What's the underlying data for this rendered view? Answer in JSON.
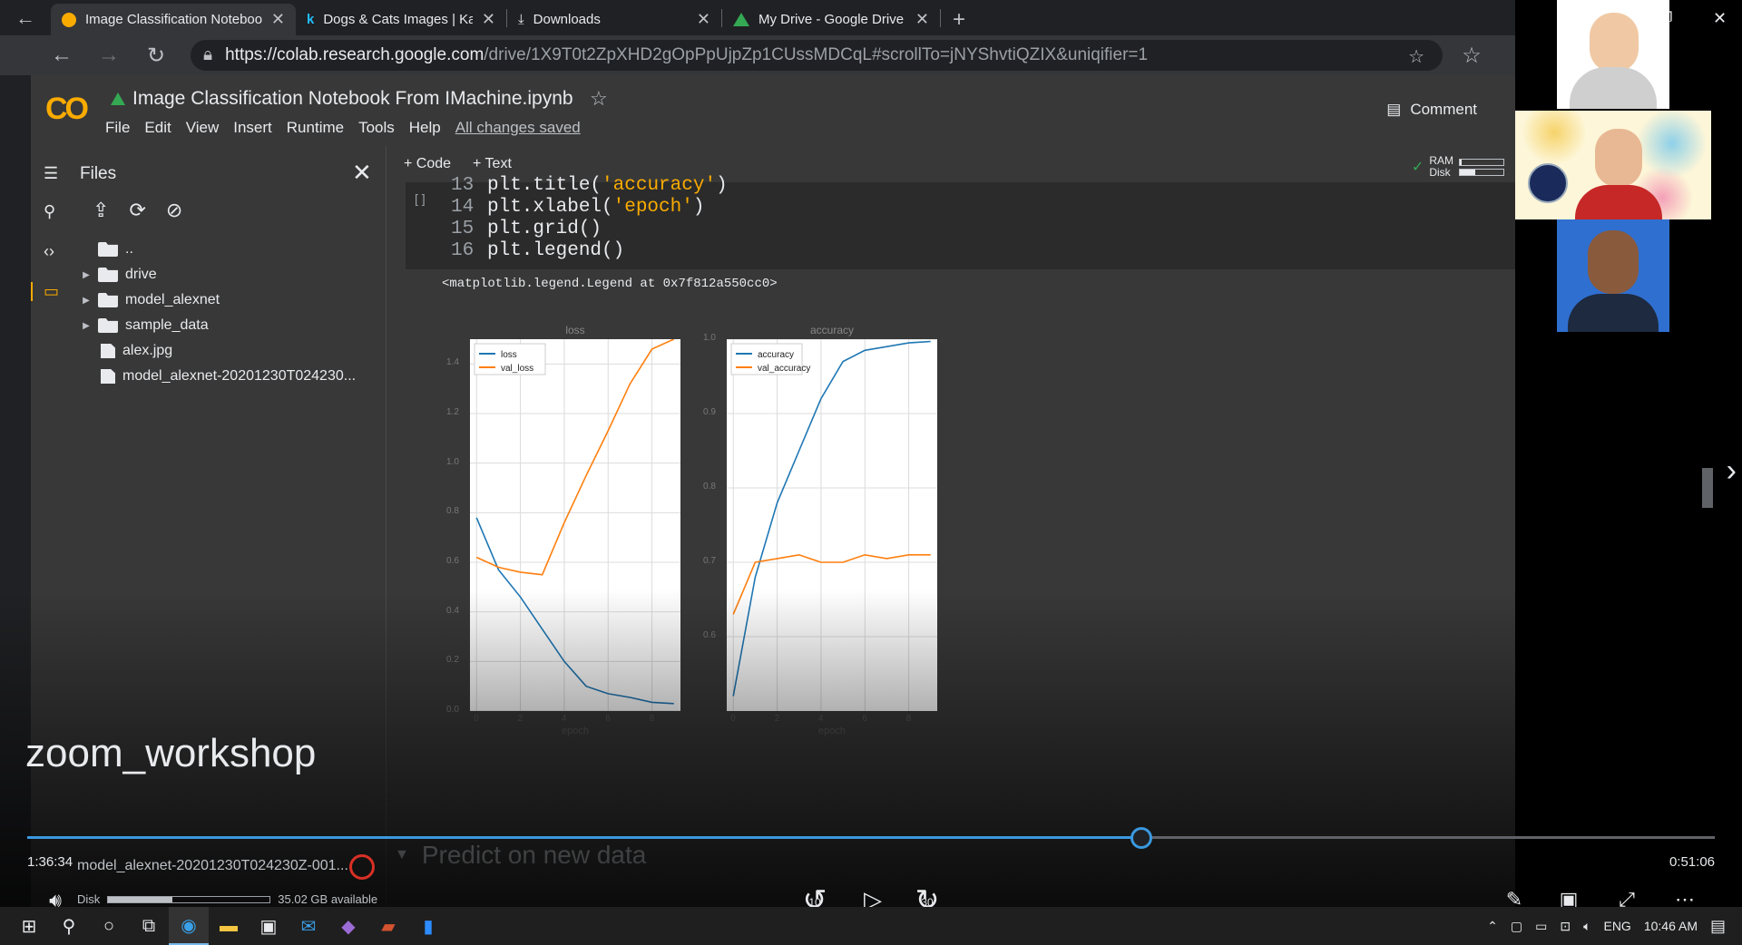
{
  "tabs": [
    {
      "title": "Image Classification Notebook F",
      "icon": "colab-icon",
      "active": true
    },
    {
      "title": "Dogs & Cats Images | Kaggle",
      "icon": "kaggle-icon",
      "active": false
    },
    {
      "title": "Downloads",
      "icon": "download-icon",
      "active": false
    },
    {
      "title": "My Drive - Google Drive",
      "icon": "drive-icon",
      "active": false
    }
  ],
  "address": {
    "host": "https://colab.research.google.com",
    "path": "/drive/1X9T0t2ZpXHD2gOpPpUjpZp1CUssMDCqL#scrollTo=jNYShvtiQZIX&uniqifier=1"
  },
  "colab": {
    "logo": "CO",
    "notebook_title": "Image Classification Notebook From IMachine.ipynb",
    "menu": [
      "File",
      "Edit",
      "View",
      "Insert",
      "Runtime",
      "Tools",
      "Help"
    ],
    "save_status": "All changes saved",
    "comment_label": "Comment",
    "add_code": "+ Code",
    "add_text": "+ Text",
    "ram_label": "RAM",
    "disk_label": "Disk",
    "ram_fraction": 0.05,
    "disk_fraction": 0.35
  },
  "sidebar": {
    "title": "Files",
    "tree": [
      {
        "name": "..",
        "kind": "up",
        "expandable": false
      },
      {
        "name": "drive",
        "kind": "folder",
        "expandable": true
      },
      {
        "name": "model_alexnet",
        "kind": "folder",
        "expandable": true
      },
      {
        "name": "sample_data",
        "kind": "folder",
        "expandable": true
      },
      {
        "name": "alex.jpg",
        "kind": "file",
        "expandable": false
      },
      {
        "name": "model_alexnet-20201230T024230...",
        "kind": "file",
        "expandable": false
      }
    ]
  },
  "code_cell": {
    "run_marker": "[ ]",
    "lines": [
      {
        "n": "13",
        "pre": "plt.title(",
        "str": "'accuracy'",
        "post": ")"
      },
      {
        "n": "14",
        "pre": "plt.xlabel(",
        "str": "'epoch'",
        "post": ")"
      },
      {
        "n": "15",
        "pre": "plt.grid()",
        "str": "",
        "post": ""
      },
      {
        "n": "16",
        "pre": "plt.legend()",
        "str": "",
        "post": ""
      }
    ],
    "output": "<matplotlib.legend.Legend at 0x7f812a550cc0>"
  },
  "chart_data": [
    {
      "type": "line",
      "title": "loss",
      "xlabel": "epoch",
      "ylim": [
        0.0,
        1.5
      ],
      "xlim": [
        -0.3,
        9.3
      ],
      "xticks": [
        0,
        2,
        4,
        6,
        8
      ],
      "yticks": [
        0.0,
        0.2,
        0.4,
        0.6,
        0.8,
        1.0,
        1.2,
        1.4
      ],
      "grid": true,
      "legend": "top-left",
      "x": [
        0,
        1,
        2,
        3,
        4,
        5,
        6,
        7,
        8,
        9
      ],
      "series": [
        {
          "name": "loss",
          "color": "#1f77b4",
          "values": [
            0.78,
            0.57,
            0.46,
            0.33,
            0.2,
            0.1,
            0.07,
            0.055,
            0.035,
            0.03
          ]
        },
        {
          "name": "val_loss",
          "color": "#ff7f0e",
          "values": [
            0.62,
            0.58,
            0.56,
            0.55,
            0.76,
            0.95,
            1.13,
            1.32,
            1.46,
            1.5
          ]
        }
      ]
    },
    {
      "type": "line",
      "title": "accuracy",
      "xlabel": "epoch",
      "ylim": [
        0.5,
        1.0
      ],
      "xlim": [
        -0.3,
        9.3
      ],
      "xticks": [
        0,
        2,
        4,
        6,
        8
      ],
      "yticks": [
        0.6,
        0.7,
        0.8,
        0.9,
        1.0
      ],
      "grid": true,
      "legend": "top-left",
      "x": [
        0,
        1,
        2,
        3,
        4,
        5,
        6,
        7,
        8,
        9
      ],
      "series": [
        {
          "name": "accuracy",
          "color": "#1f77b4",
          "values": [
            0.52,
            0.68,
            0.78,
            0.85,
            0.92,
            0.97,
            0.985,
            0.99,
            0.995,
            0.997
          ]
        },
        {
          "name": "val_accuracy",
          "color": "#ff7f0e",
          "values": [
            0.63,
            0.7,
            0.705,
            0.71,
            0.7,
            0.7,
            0.71,
            0.705,
            0.71,
            0.71
          ]
        }
      ]
    }
  ],
  "next_section": "Predict on new data",
  "recording_label": "zoom_workshop",
  "player": {
    "elapsed": "1:36:34",
    "total": "0:51:06",
    "progress_fraction": 0.66,
    "snackbar_file": "model_alexnet-20201230T024230Z-001...",
    "disk_available": "35.02 GB available",
    "disk_label": "Disk",
    "rewind_label": "10",
    "forward_label": "30"
  },
  "taskbar": {
    "language": "ENG",
    "clock": "10:46 AM"
  }
}
